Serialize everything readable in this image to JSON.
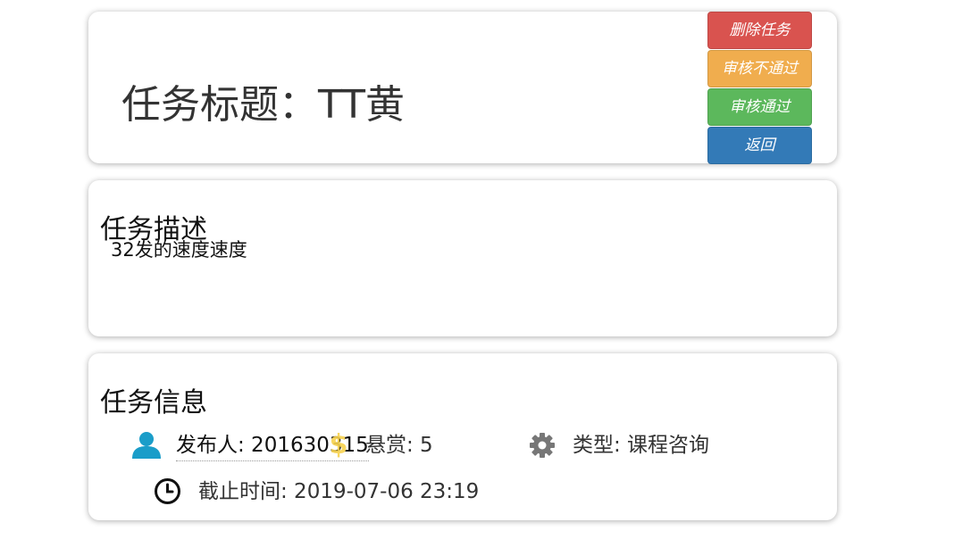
{
  "task": {
    "title": "任务标题：TT黄"
  },
  "actions": {
    "delete_label": "删除任务",
    "reject_label": "审核不通过",
    "approve_label": "审核通过",
    "back_label": "返回"
  },
  "description": {
    "heading": "任务描述",
    "text": "32发的速度速度"
  },
  "info": {
    "heading": "任务信息",
    "publisher": "发布人: 201630315",
    "reward": "悬赏: 5",
    "type": "类型: 课程咨询",
    "deadline": "截止时间: 2019-07-06 23:19"
  },
  "colors": {
    "danger": "#d9534f",
    "warning": "#f0ad4e",
    "success": "#5cb85c",
    "primary": "#337ab7",
    "user_icon": "#1a9dc9",
    "dollar_icon": "#f7d24f",
    "gear_icon": "#777777",
    "clock_icon": "#111111"
  },
  "icons": {
    "publisher": "user-icon",
    "reward": "dollar-icon",
    "type": "gear-icon",
    "deadline": "clock-icon"
  }
}
